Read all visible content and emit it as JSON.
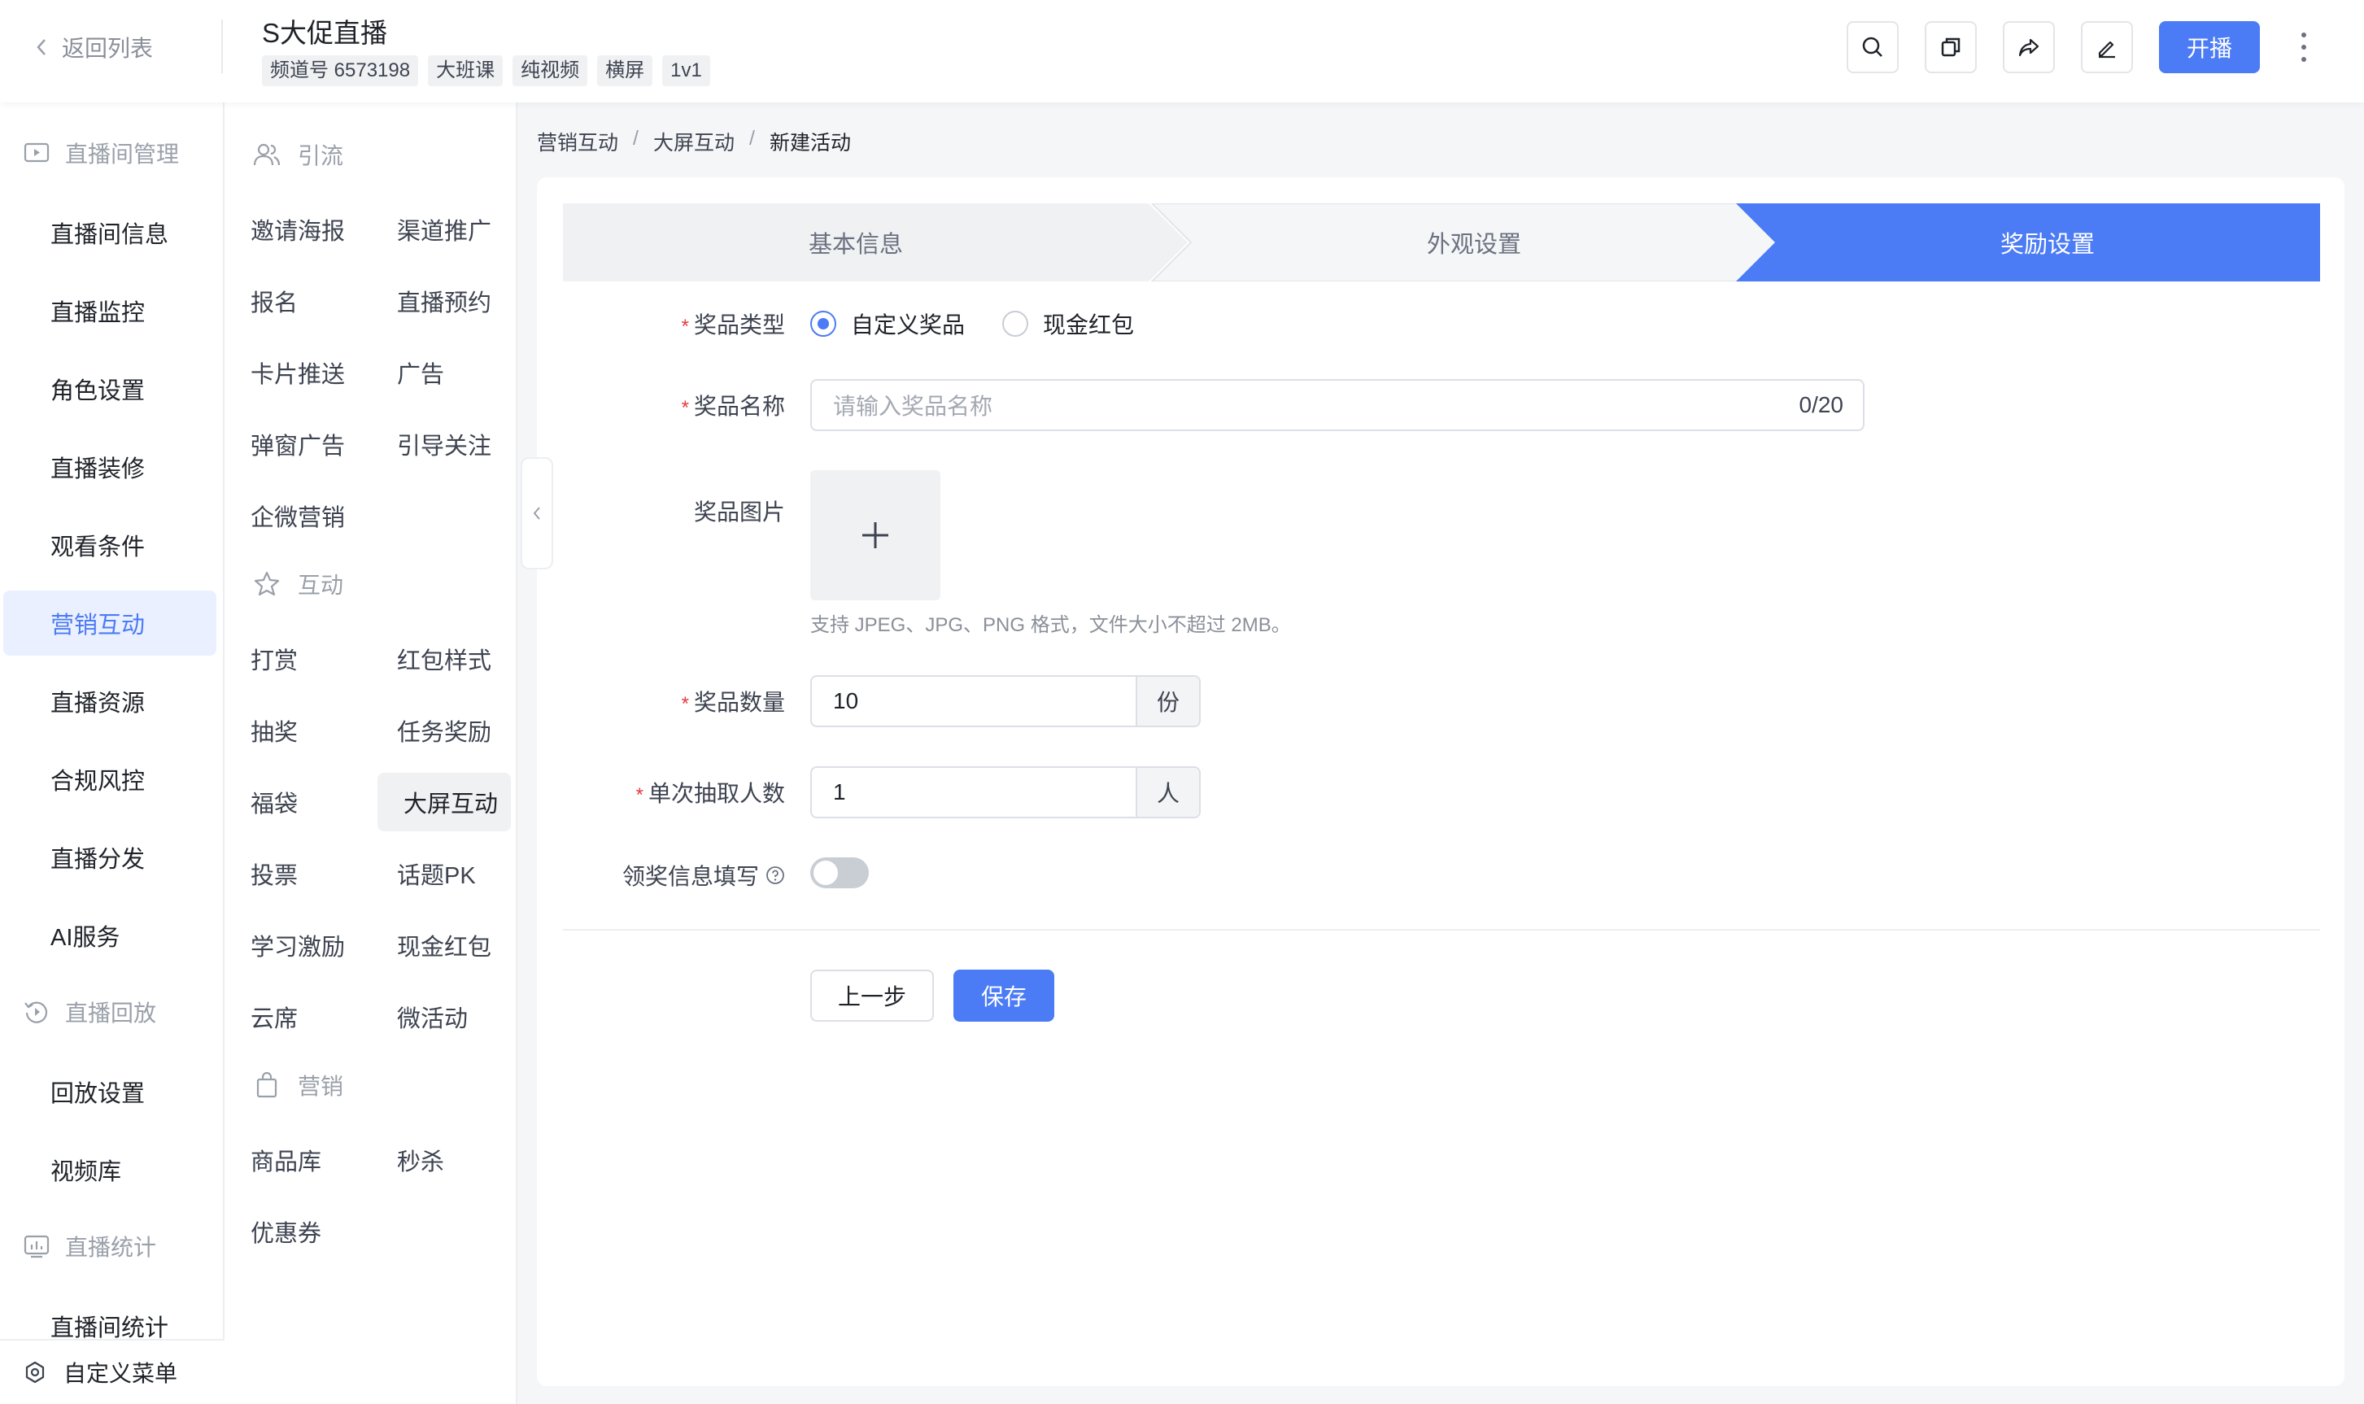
{
  "header": {
    "back_label": "返回列表",
    "title": "S大促直播",
    "tags": [
      "频道号 6573198",
      "大班课",
      "纯视频",
      "横屏",
      "1v1"
    ],
    "start_label": "开播"
  },
  "sidebar": {
    "group1": "直播间管理",
    "items1": [
      "直播间信息",
      "直播监控",
      "角色设置",
      "直播装修",
      "观看条件",
      "营销互动",
      "直播资源",
      "合规风控",
      "直播分发",
      "AI服务"
    ],
    "group2": "直播回放",
    "items2": [
      "回放设置",
      "视频库"
    ],
    "group3": "直播统计",
    "items3": [
      "直播间统计"
    ],
    "bottom": "自定义菜单"
  },
  "submenu": {
    "group1": "引流",
    "items1": [
      "邀请海报",
      "渠道推广",
      "报名",
      "直播预约",
      "卡片推送",
      "广告",
      "弹窗广告",
      "引导关注",
      "企微营销"
    ],
    "group2": "互动",
    "items2": [
      "打赏",
      "红包样式",
      "抽奖",
      "任务奖励",
      "福袋",
      "大屏互动",
      "投票",
      "话题PK",
      "学习激励",
      "现金红包",
      "云席",
      "微活动"
    ],
    "group3": "营销",
    "items3": [
      "商品库",
      "秒杀",
      "优惠券"
    ]
  },
  "breadcrumb": [
    "营销互动",
    "大屏互动",
    "新建活动"
  ],
  "steps": [
    "基本信息",
    "外观设置",
    "奖励设置"
  ],
  "form": {
    "prize_type_label": "奖品类型",
    "prize_type_options": [
      "自定义奖品",
      "现金红包"
    ],
    "prize_name_label": "奖品名称",
    "prize_name_placeholder": "请输入奖品名称",
    "prize_name_count": "0/20",
    "prize_image_label": "奖品图片",
    "prize_image_hint": "支持 JPEG、JPG、PNG 格式，文件大小不超过 2MB。",
    "prize_qty_label": "奖品数量",
    "prize_qty_value": "10",
    "prize_qty_unit": "份",
    "draw_count_label": "单次抽取人数",
    "draw_count_value": "1",
    "draw_count_unit": "人",
    "claim_info_label": "领奖信息填写",
    "prev_label": "上一步",
    "save_label": "保存"
  },
  "colors": {
    "primary": "#4b7bf5",
    "active_bg": "#eaf0ff"
  }
}
